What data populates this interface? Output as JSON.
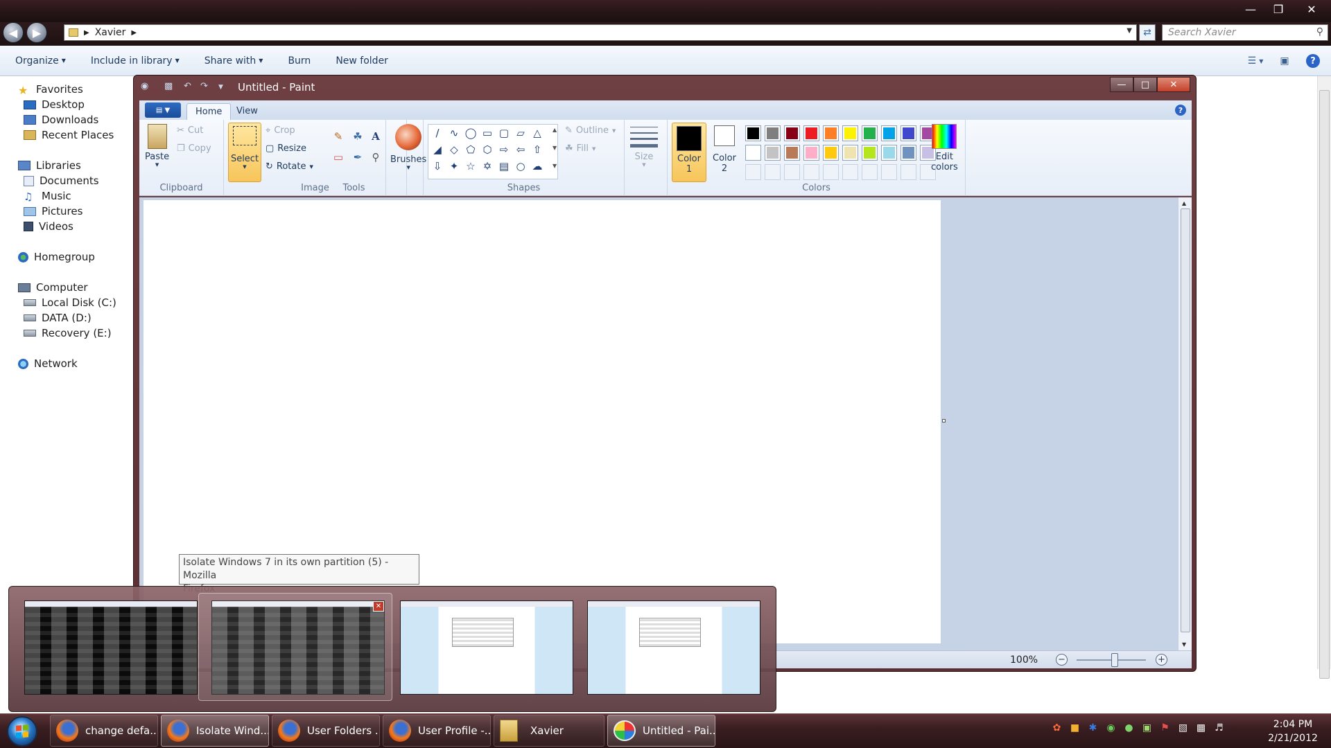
{
  "explorer": {
    "address": {
      "crumbs": [
        "Xavier"
      ]
    },
    "search": {
      "placeholder": "Search Xavier"
    },
    "toolbar": {
      "organize": "Organize",
      "include_in_library": "Include in library",
      "share_with": "Share with",
      "burn": "Burn",
      "new_folder": "New folder"
    },
    "nav": {
      "favorites": "Favorites",
      "desktop": "Desktop",
      "downloads": "Downloads",
      "recent_places": "Recent Places",
      "libraries": "Libraries",
      "documents": "Documents",
      "music": "Music",
      "pictures": "Pictures",
      "videos": "Videos",
      "homegroup": "Homegroup",
      "computer": "Computer",
      "local_disk": "Local Disk (C:)",
      "data_disk": "DATA (D:)",
      "recovery_disk": "Recovery (E:)",
      "network": "Network"
    }
  },
  "paint": {
    "title": "Untitled - Paint",
    "tabs": {
      "home": "Home",
      "view": "View"
    },
    "clipboard": {
      "paste": "Paste",
      "cut": "Cut",
      "copy": "Copy",
      "label": "Clipboard"
    },
    "image": {
      "select": "Select",
      "crop": "Crop",
      "resize": "Resize",
      "rotate": "Rotate",
      "label": "Image"
    },
    "tools": {
      "label": "Tools"
    },
    "brushes": {
      "label": "Brushes"
    },
    "shapes": {
      "label": "Shapes",
      "outline": "Outline",
      "fill": "Fill"
    },
    "size": {
      "label": "Size"
    },
    "colors": {
      "color1": "Color",
      "color1_num": "1",
      "color2": "Color",
      "color2_num": "2",
      "edit": "Edit",
      "edit2": "colors",
      "label": "Colors",
      "color1_value": "#000000",
      "color2_value": "#ffffff",
      "palette_row1": [
        "#000000",
        "#7f7f7f",
        "#880015",
        "#ed1c24",
        "#ff7f27",
        "#fff200",
        "#22b14c",
        "#00a2e8",
        "#3f48cc",
        "#a349a4"
      ],
      "palette_row2": [
        "#ffffff",
        "#c3c3c3",
        "#b97a57",
        "#ffaec9",
        "#ffc90e",
        "#efe4b0",
        "#b5e61d",
        "#99d9ea",
        "#7092be",
        "#c8bfe7"
      ]
    },
    "status": {
      "zoom": "100%"
    }
  },
  "tooltip": {
    "line1": "Isolate Windows 7 in its own partition (5) - Mozilla",
    "line2": "Firefox"
  },
  "taskbar": {
    "items": [
      {
        "label": "change defa..."
      },
      {
        "label": "Isolate Wind..."
      },
      {
        "label": "User Folders ..."
      },
      {
        "label": "User Profile -..."
      },
      {
        "label": "Xavier"
      },
      {
        "label": "Untitled - Pai..."
      }
    ],
    "clock": {
      "time": "2:04 PM",
      "date": "2/21/2012"
    }
  }
}
